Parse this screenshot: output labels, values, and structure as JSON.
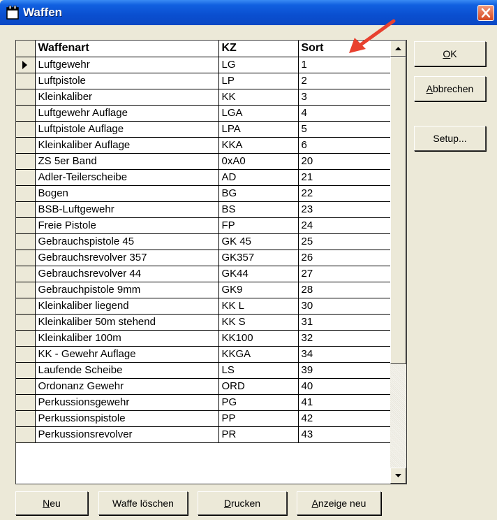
{
  "window": {
    "title": "Waffen"
  },
  "grid": {
    "columns": [
      "Waffenart",
      "KZ",
      "Sort"
    ],
    "rows": [
      [
        "Luftgewehr",
        "LG",
        "1"
      ],
      [
        "Luftpistole",
        "LP",
        "2"
      ],
      [
        "Kleinkaliber",
        "KK",
        "3"
      ],
      [
        "Luftgewehr Auflage",
        "LGA",
        "4"
      ],
      [
        "Luftpistole Auflage",
        "LPA",
        "5"
      ],
      [
        "Kleinkaliber Auflage",
        "KKA",
        "6"
      ],
      [
        "ZS 5er Band",
        "0xA0",
        "20"
      ],
      [
        "Adler-Teilerscheibe",
        "AD",
        "21"
      ],
      [
        "Bogen",
        "BG",
        "22"
      ],
      [
        "BSB-Luftgewehr",
        "BS",
        "23"
      ],
      [
        "Freie Pistole",
        "FP",
        "24"
      ],
      [
        "Gebrauchspistole 45",
        "GK 45",
        "25"
      ],
      [
        "Gebrauchsrevolver 357",
        "GK357",
        "26"
      ],
      [
        "Gebrauchsrevolver 44",
        "GK44",
        "27"
      ],
      [
        "Gebrauchpistole 9mm",
        "GK9",
        "28"
      ],
      [
        "Kleinkaliber liegend",
        "KK L",
        "30"
      ],
      [
        "Kleinkaliber 50m stehend",
        "KK S",
        "31"
      ],
      [
        "Kleinkaliber 100m",
        "KK100",
        "32"
      ],
      [
        "KK - Gewehr Auflage",
        "KKGA",
        "34"
      ],
      [
        "Laufende Scheibe",
        "LS",
        "39"
      ],
      [
        "Ordonanz Gewehr",
        "ORD",
        "40"
      ],
      [
        "Perkussionsgewehr",
        "PG",
        "41"
      ],
      [
        "Perkussionspistole",
        "PP",
        "42"
      ],
      [
        "Perkussionsrevolver",
        "PR",
        "43"
      ]
    ],
    "current_row": 0
  },
  "side_buttons": {
    "ok_prefix": "",
    "ok_mnemonic": "O",
    "ok_rest": "K",
    "cancel_prefix": "",
    "cancel_mnemonic": "A",
    "cancel_rest": "bbrechen",
    "setup": "Setup..."
  },
  "bottom_buttons": {
    "new_prefix": "",
    "new_mnemonic": "N",
    "new_rest": "eu",
    "delete": "Waffe löschen",
    "print_prefix": "",
    "print_mnemonic": "D",
    "print_rest": "rucken",
    "refresh_prefix": "",
    "refresh_mnemonic": "A",
    "refresh_rest": "nzeige neu"
  },
  "icons": {
    "title": "app-icon",
    "close": "close-icon",
    "scroll_up": "triangle-up-icon",
    "scroll_down": "triangle-down-icon",
    "row_pointer": "row-pointer-icon",
    "annotation": "red-arrow-icon"
  },
  "colors": {
    "annotation": "#e8412f",
    "titlebar": "#0a4fd0"
  }
}
